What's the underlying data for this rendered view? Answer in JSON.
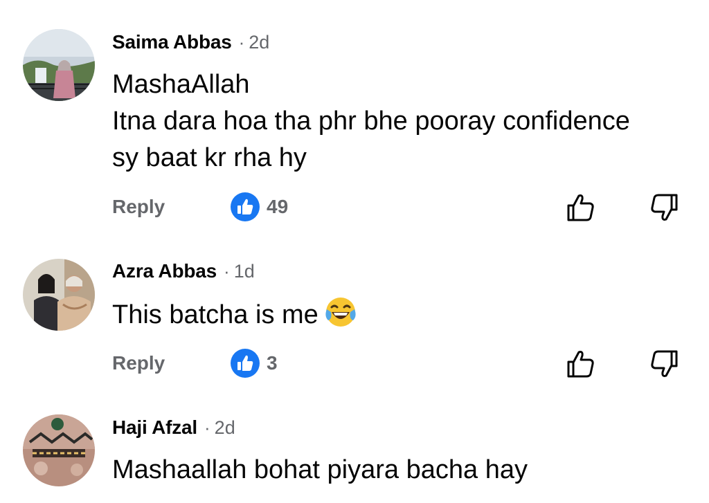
{
  "comments": [
    {
      "author": "Saima Abbas",
      "separator": "·",
      "time": "2d",
      "lines": [
        "MashaAllah",
        "Itna dara hoa tha phr bhe pooray confidence",
        "sy baat kr rha hy"
      ],
      "reply_label": "Reply",
      "like_count": "49"
    },
    {
      "author": "Azra Abbas",
      "separator": "·",
      "time": "1d",
      "lines": [
        "This batcha is me"
      ],
      "emoji": "face-with-tears-of-joy-icon",
      "reply_label": "Reply",
      "like_count": "3"
    },
    {
      "author": "Haji Afzal",
      "separator": "·",
      "time": "2d",
      "lines": [
        "Mashaallah bohat piyara bacha hay"
      ]
    }
  ],
  "colors": {
    "text": "#050505",
    "secondary": "#65676b",
    "like_blue": "#1877f2"
  },
  "icons": {
    "like_badge": "thumbs-up-badge-icon",
    "upvote": "thumbs-up-outline-icon",
    "downvote": "thumbs-down-outline-icon"
  }
}
